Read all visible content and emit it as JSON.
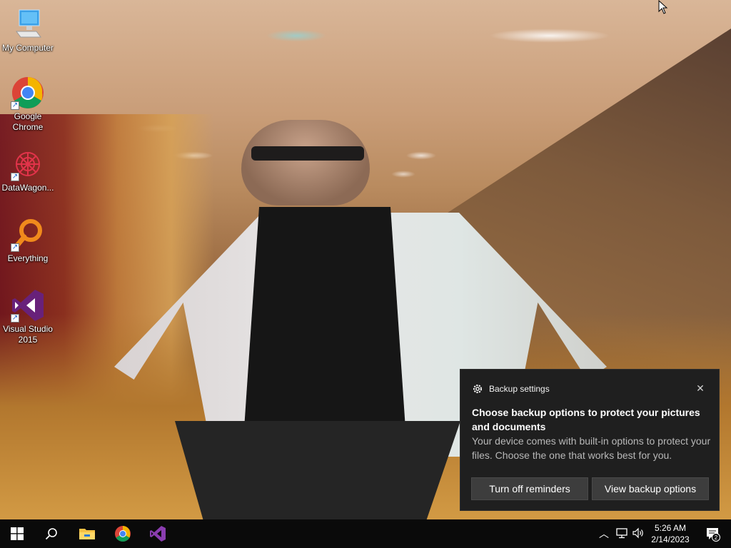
{
  "desktop": {
    "icons": [
      {
        "label": "My Computer",
        "icon": "computer-icon",
        "shortcut": false
      },
      {
        "label": "Google Chrome",
        "icon": "chrome-icon",
        "shortcut": true
      },
      {
        "label": "DataWagon...",
        "icon": "datawagon-icon",
        "shortcut": true
      },
      {
        "label": "Everything",
        "icon": "search-magnifier-icon",
        "shortcut": true
      },
      {
        "label": "Visual Studio 2015",
        "icon": "visual-studio-icon",
        "shortcut": true
      }
    ]
  },
  "notification": {
    "app_name": "Backup settings",
    "title": "Choose backup options to protect your pictures and documents",
    "body": "Your device comes with built-in options to protect your files. Choose the one that works best for you.",
    "buttons": {
      "turn_off": "Turn off reminders",
      "view": "View backup options"
    }
  },
  "taskbar": {
    "pinned": [
      "windows-start-icon",
      "search-icon",
      "file-explorer-icon",
      "chrome-icon",
      "visual-studio-icon"
    ],
    "clock": {
      "time": "5:26 AM",
      "date": "2/14/2023"
    },
    "notification_count": "2"
  },
  "colors": {
    "toast_bg": "#1f1f1f",
    "button_bg": "#3d3d3d",
    "taskbar_bg": "#0a0a0a",
    "visual_studio_purple": "#68217a"
  }
}
